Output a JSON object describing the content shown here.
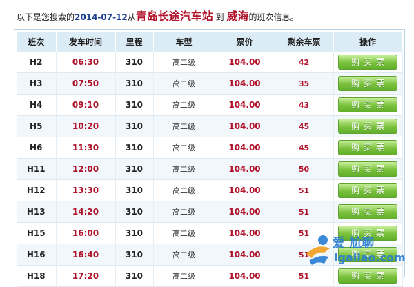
{
  "heading": {
    "prefix": "以下是您搜索的",
    "date": "2014-07-12",
    "from_word": "从",
    "origin": "青岛长途汽车站",
    "to_word": "到",
    "destination": "威海",
    "suffix": "的班次信息。"
  },
  "table": {
    "columns": [
      "班次",
      "发车时间",
      "里程",
      "车型",
      "票价",
      "剩余车票",
      "操作"
    ],
    "rows": [
      {
        "code": "H2",
        "time": "06:30",
        "distance": "310",
        "type": "高二级",
        "price": "104.00",
        "remaining": "42"
      },
      {
        "code": "H3",
        "time": "07:50",
        "distance": "310",
        "type": "高二级",
        "price": "104.00",
        "remaining": "35"
      },
      {
        "code": "H4",
        "time": "09:10",
        "distance": "310",
        "type": "高二级",
        "price": "104.00",
        "remaining": "43"
      },
      {
        "code": "H5",
        "time": "10:20",
        "distance": "310",
        "type": "高二级",
        "price": "104.00",
        "remaining": "45"
      },
      {
        "code": "H6",
        "time": "11:30",
        "distance": "310",
        "type": "高二级",
        "price": "104.00",
        "remaining": "45"
      },
      {
        "code": "H11",
        "time": "12:00",
        "distance": "310",
        "type": "高二级",
        "price": "104.00",
        "remaining": "50"
      },
      {
        "code": "H12",
        "time": "13:30",
        "distance": "310",
        "type": "高二级",
        "price": "104.00",
        "remaining": "51"
      },
      {
        "code": "H13",
        "time": "14:20",
        "distance": "310",
        "type": "高二级",
        "price": "104.00",
        "remaining": "51"
      },
      {
        "code": "H15",
        "time": "16:00",
        "distance": "310",
        "type": "高二级",
        "price": "104.00",
        "remaining": "51"
      },
      {
        "code": "H16",
        "time": "16:40",
        "distance": "310",
        "type": "高二级",
        "price": "104.00",
        "remaining": "51"
      },
      {
        "code": "H18",
        "time": "17:20",
        "distance": "310",
        "type": "高二级",
        "price": "104.00",
        "remaining": "51"
      }
    ],
    "buy_label": "购买票"
  },
  "watermark": {
    "text": "爱 尬聊",
    "url": "igaliao.com"
  },
  "colors": {
    "accent_red": "#b0122a",
    "date_blue": "#1a3f8f",
    "header_bg": "#dcecf7",
    "button_green": "#79c13c"
  }
}
